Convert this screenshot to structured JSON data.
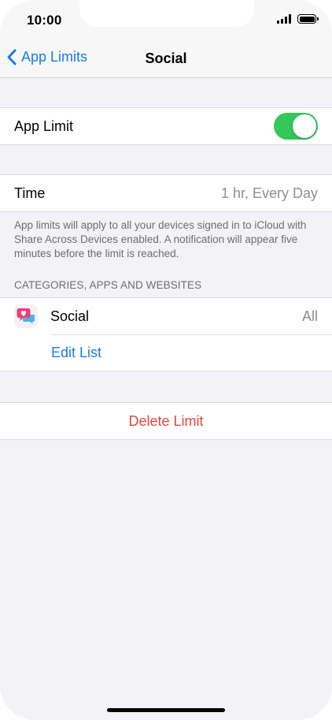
{
  "status_bar": {
    "time": "10:00"
  },
  "nav": {
    "back_label": "App Limits",
    "title": "Social"
  },
  "app_limit": {
    "label": "App Limit",
    "enabled": true
  },
  "time": {
    "label": "Time",
    "value": "1 hr, Every Day"
  },
  "note": "App limits will apply to all your devices signed in to iCloud with Share Across Devices enabled. A notification will appear five minutes before the limit is reached.",
  "categories": {
    "header": "CATEGORIES, APPS AND WEBSITES",
    "items": [
      {
        "name": "Social",
        "value": "All",
        "icon": "social-category-icon"
      }
    ],
    "edit_label": "Edit List"
  },
  "delete_label": "Delete Limit",
  "colors": {
    "accent": "#1a7ce6",
    "toggle_on": "#34c759",
    "destructive": "#e2463f",
    "background": "#f2f2f7"
  }
}
